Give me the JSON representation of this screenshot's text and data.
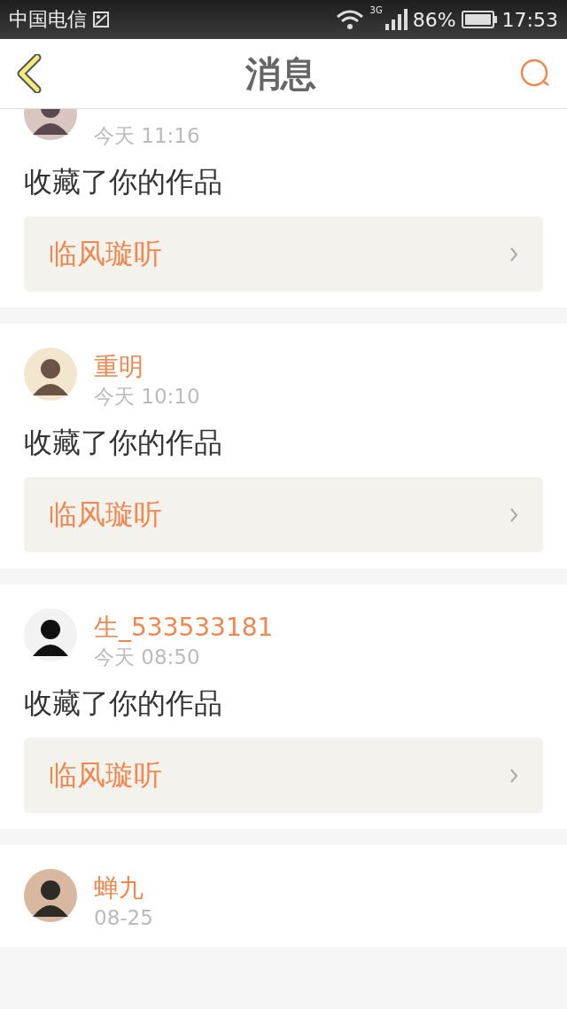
{
  "status_bar": {
    "carrier": "中国电信",
    "network": "3G",
    "battery": "86%",
    "time": "17:53"
  },
  "header": {
    "title": "消息"
  },
  "messages": [
    {
      "time": "今天 11:16",
      "action": "收藏了你的作品",
      "work": "临风璇听"
    },
    {
      "name": "重明",
      "time": "今天 10:10",
      "action": "收藏了你的作品",
      "work": "临风璇听"
    },
    {
      "name": "生_533533181",
      "time": "今天 08:50",
      "action": "收藏了你的作品",
      "work": "临风璇听"
    },
    {
      "name": "蝉九",
      "time": "08-25"
    }
  ]
}
